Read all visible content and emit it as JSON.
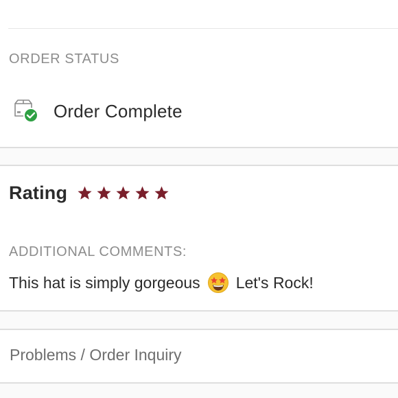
{
  "order_status": {
    "label": "ORDER STATUS",
    "value": "Order Complete",
    "icon": "package-complete-icon",
    "check_color": "#2ea043"
  },
  "rating": {
    "label": "Rating",
    "stars": 5,
    "max_stars": 5,
    "star_color": "#7a1f2b"
  },
  "comments": {
    "label": "ADDITIONAL COMMENTS:",
    "text_before": "This hat is simply gorgeous",
    "emoji": "star-struck-emoji-icon",
    "text_after": "Let's Rock!"
  },
  "links": {
    "problems": "Problems / Order Inquiry"
  }
}
